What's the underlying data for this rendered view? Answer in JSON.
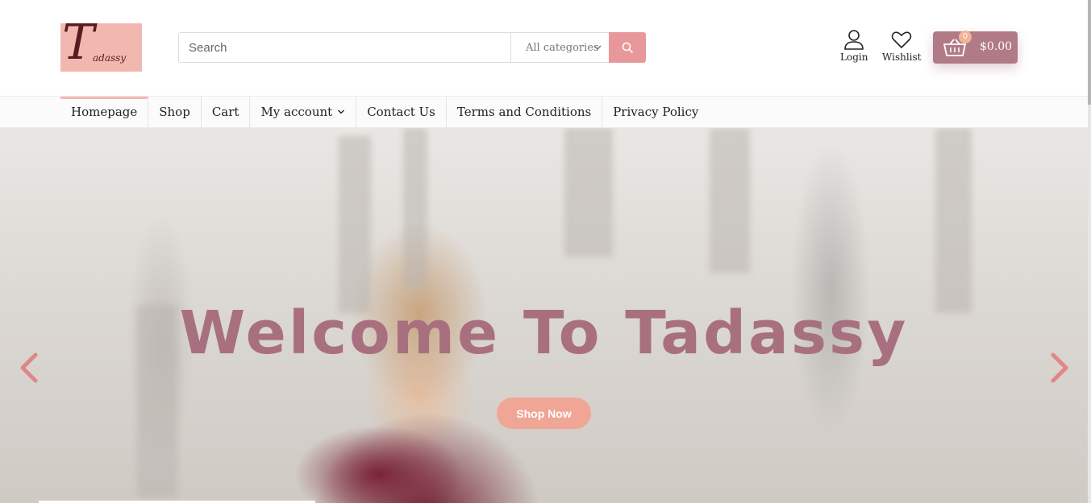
{
  "header": {
    "logo": {
      "letter": "T",
      "rest": "adassy",
      "bg_color": "#f2b8b0",
      "text_color": "#5a1a1f"
    },
    "search": {
      "placeholder": "Search",
      "category_selected": "All categories",
      "button_icon": "search-icon",
      "button_color": "#e8979b"
    },
    "login_label": "Login",
    "wishlist_label": "Wishlist",
    "cart": {
      "count": "0",
      "total": "$0.00",
      "color": "#b07a86",
      "badge_color": "#f3b395"
    }
  },
  "nav": {
    "items": [
      {
        "label": "Homepage",
        "active": true
      },
      {
        "label": "Shop"
      },
      {
        "label": "Cart"
      },
      {
        "label": "My account",
        "has_dropdown": true
      },
      {
        "label": "Contact Us"
      },
      {
        "label": "Terms and Conditions"
      },
      {
        "label": "Privacy Policy"
      }
    ],
    "active_color": "#f2b8b0"
  },
  "hero": {
    "title": "Welcome To Tadassy",
    "button_label": "Shop Now",
    "title_color": "#a8707e",
    "button_color": "#f0a595",
    "arrow_color": "#e0868a"
  }
}
